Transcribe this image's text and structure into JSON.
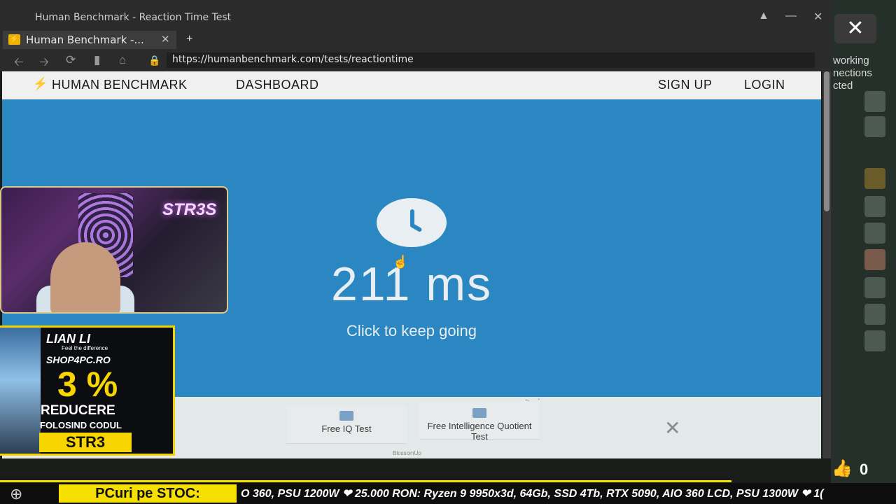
{
  "window": {
    "title": "Human Benchmark - Reaction Time Test",
    "pin_icon": "pin-icon",
    "minimize_icon": "minimize-icon",
    "close_icon": "close-icon"
  },
  "tab": {
    "title": "Human Benchmark -...",
    "favicon": "⚡",
    "close": "✕",
    "new": "+"
  },
  "address_bar": {
    "url": "https://humanbenchmark.com/tests/reactiontime"
  },
  "site_nav": {
    "logo_icon": "bolt-icon",
    "brand": "HUMAN BENCHMARK",
    "dashboard": "DASHBOARD",
    "signup": "SIGN UP",
    "login": "LOGIN"
  },
  "test": {
    "result": "211 ms",
    "instruction": "Click to keep going",
    "icon": "clock-icon"
  },
  "ad": {
    "card1": "Free IQ Test",
    "card2": "Free Intelligence Quotient Test",
    "brand": "BlossomUp",
    "close": "✕"
  },
  "side_panel": {
    "close": "✕",
    "text_lines": [
      "working",
      "nections",
      "cted"
    ],
    "like_count": "0"
  },
  "webcam": {
    "neon_sign": "STR3S"
  },
  "sponsor": {
    "brand": "LIAN LI",
    "tagline": "Feel the difference",
    "shop": "SHOP4PC.RO",
    "discount": "3 %",
    "reduction": "REDUCERE",
    "using_code": "FOLOSIND CODUL",
    "code": "STR3"
  },
  "ticker": {
    "label": "PCuri pe STOC:",
    "text": "O 360, PSU 1200W  ❤ 25.000 RON: Ryzen 9 9950x3d, 64Gb, SSD 4Tb, RTX 5090, AIO 360 LCD, PSU 1300W ❤ 1("
  },
  "colors": {
    "test_blue": "#2b87c1",
    "accent_yellow": "#f5e000"
  }
}
